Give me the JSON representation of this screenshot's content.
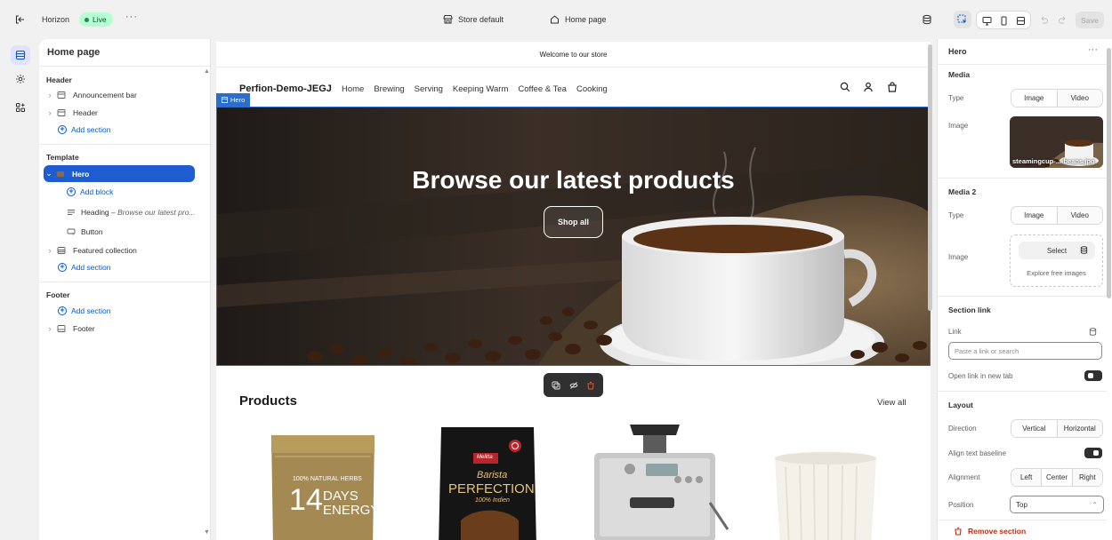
{
  "topbar": {
    "theme_name": "Horizon",
    "live_label": "Live",
    "more": "···",
    "store_default": "Store default",
    "home_page": "Home page",
    "save": "Save"
  },
  "left": {
    "title": "Home page",
    "header_group": "Header",
    "announcement_bar": "Announcement bar",
    "header_item": "Header",
    "add_section": "Add section",
    "template_group": "Template",
    "hero": "Hero",
    "add_block": "Add block",
    "heading_block": "Heading",
    "heading_suffix": " – Browse our latest pro...",
    "button_block": "Button",
    "featured_collection": "Featured collection",
    "footer_group": "Footer",
    "footer_item": "Footer"
  },
  "store": {
    "announcement": "Welcome to our store",
    "logo": "Perfion-Demo-JEGJ",
    "nav": [
      "Home",
      "Brewing",
      "Serving",
      "Keeping Warm",
      "Coffee & Tea",
      "Cooking"
    ],
    "hero_tag": "Hero",
    "hero_title": "Browse our latest products",
    "hero_button": "Shop all",
    "products_title": "Products",
    "view_all": "View all",
    "products": [
      {
        "name": "14 Days Energy pouch",
        "line1": "100% NATURAL HERBS",
        "line2": "14",
        "line3": "DAYS",
        "line4": "ENERGY"
      },
      {
        "name": "Melitta Barista Perfection",
        "brand": "Melitta",
        "line1": "Barista",
        "line2": "PERFECTION",
        "line3": "100% Indien"
      },
      {
        "name": "Espresso machine"
      },
      {
        "name": "Ceramic cup"
      }
    ]
  },
  "right": {
    "title": "Hero",
    "media": "Media",
    "type_label": "Type",
    "image_opt": "Image",
    "video_opt": "Video",
    "image_label": "Image",
    "image_file": "steamingcup-...-beans.jpg",
    "media2": "Media 2",
    "select": "Select",
    "explore": "Explore free images",
    "section_link": "Section link",
    "link_label": "Link",
    "link_placeholder": "Paste a link or search",
    "open_new_tab": "Open link in new tab",
    "layout": "Layout",
    "direction_label": "Direction",
    "vertical": "Vertical",
    "horizontal": "Horizontal",
    "align_baseline": "Align text baseline",
    "alignment_label": "Alignment",
    "left_opt": "Left",
    "center_opt": "Center",
    "right_opt": "Right",
    "position_label": "Position",
    "position_value": "Top",
    "remove_section": "Remove section"
  },
  "colors": {
    "accent": "#005bd3",
    "selected": "#1f5ccf",
    "hero_outline": "#2c6ecb",
    "danger": "#c5280c",
    "live_bg": "#b4fed2"
  }
}
